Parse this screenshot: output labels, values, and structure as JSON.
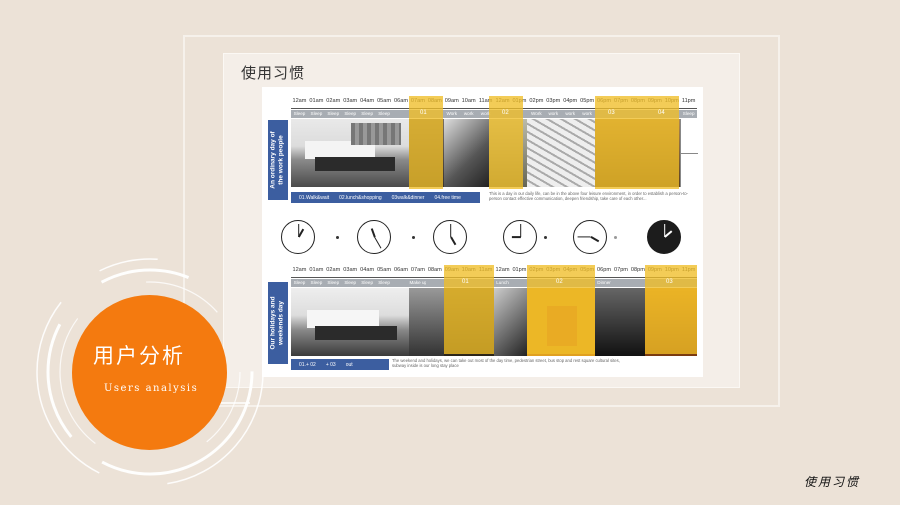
{
  "page": {
    "title": "使用习惯",
    "bottom_text": "使用习惯"
  },
  "badge": {
    "title": "用户分析",
    "subtitle": "Users analysis"
  },
  "sheet": {
    "hours": [
      "12am",
      "01am",
      "02am",
      "03am",
      "04am",
      "05am",
      "06am",
      "07am",
      "08am",
      "09am",
      "10am",
      "11am",
      "12am",
      "01pm",
      "02pm",
      "03pm",
      "04pm",
      "05pm",
      "06pm",
      "07pm",
      "08pm",
      "09pm",
      "10pm",
      "11pm"
    ],
    "workday": {
      "label_line1": "An ordinary day of",
      "label_line2": "the work people",
      "activities": [
        "Sleep",
        "Sleep",
        "Sleep",
        "Sleep",
        "Sleep",
        "Sleep",
        "",
        "",
        "",
        "Work",
        "work",
        "work",
        "",
        "",
        "Work",
        "work",
        "work",
        "work",
        "",
        "",
        "",
        "",
        "",
        "Sleep"
      ],
      "cells": [
        "01",
        "02",
        "03",
        "04"
      ],
      "legend": [
        "01.Walk&wait",
        "02.lunch&shopping",
        "03walk&dinner",
        "04.free time"
      ],
      "caption": "This is a day in our daily life, can be in the above four leisure environment, in order to establish a person-to-person contact effective communication, deepen friendship, take care of each other..."
    },
    "weekend": {
      "label_line1": "Our holidays and",
      "label_line2": "weekends day",
      "activities": [
        "Sleep",
        "Sleep",
        "Sleep",
        "Sleep",
        "Sleep",
        "Sleep",
        "",
        "Make up/break",
        "",
        "",
        "",
        "",
        "Lunch",
        "",
        "",
        "",
        "",
        "",
        "Dinner",
        "",
        "",
        "",
        "",
        ""
      ],
      "cells": [
        "01",
        "02",
        "03"
      ],
      "legend": [
        "01.+ 02",
        "+ 03",
        "out"
      ],
      "caption": "The weekend and holidays, we can take out most of the day time, pedestrian street, bus stop and rest square cultural sites, subway inside is our long stay place"
    }
  },
  "colors": {
    "background": "#ece2d7",
    "accent_orange": "#f47a0f",
    "label_blue": "#3c5ea0",
    "highlight_yellow": "#f0be28"
  }
}
